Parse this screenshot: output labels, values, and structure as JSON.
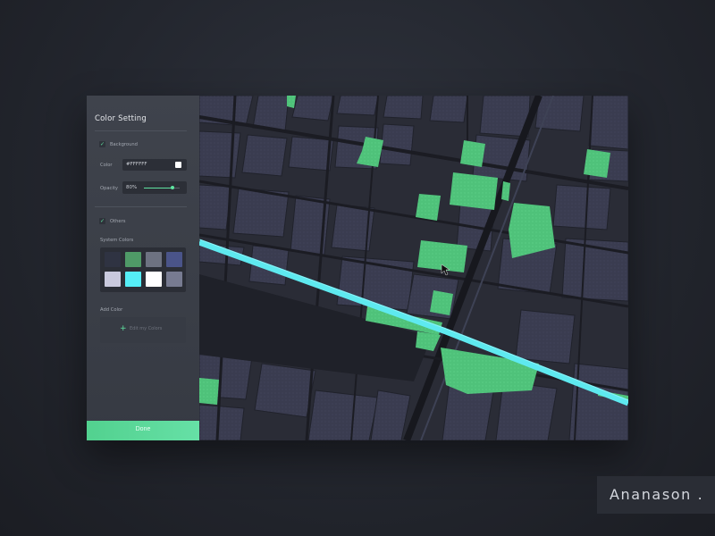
{
  "panel": {
    "title": "Color Setting",
    "background": {
      "label": "Background",
      "checked": true,
      "color_label": "Color",
      "color_value": "#FFFFFF",
      "opacity_label": "Opacity",
      "opacity_value": "80%",
      "opacity_fraction": 0.8
    },
    "others": {
      "label": "Others",
      "checked": true
    },
    "system_colors": {
      "label": "System Colors",
      "swatches": [
        {
          "name": "dark-slate",
          "color": "#2f3342"
        },
        {
          "name": "green",
          "color": "#4f9a67"
        },
        {
          "name": "gray",
          "color": "#6d7281"
        },
        {
          "name": "indigo",
          "color": "#4a5489"
        },
        {
          "name": "lavender",
          "color": "#c9c9dd"
        },
        {
          "name": "cyan",
          "color": "#55eef7"
        },
        {
          "name": "white",
          "color": "#ffffff"
        },
        {
          "name": "cool-gray",
          "color": "#777b91"
        }
      ]
    },
    "add_color": {
      "label": "Add Color",
      "button_label": "Edit my Colors",
      "icon": "plus-icon"
    },
    "done_label": "Done"
  },
  "brand": "Ananason .",
  "map": {
    "colors": {
      "ground": "#2c2e38",
      "blocks": "#3a3c50",
      "roads": "#1c1d24",
      "parks": "#4fc27a",
      "river": "#5ee9ef",
      "pointer": "mouse-pointer-icon"
    }
  },
  "colors": {
    "accent": "#5fe3a1",
    "panel": "#3c4049"
  }
}
